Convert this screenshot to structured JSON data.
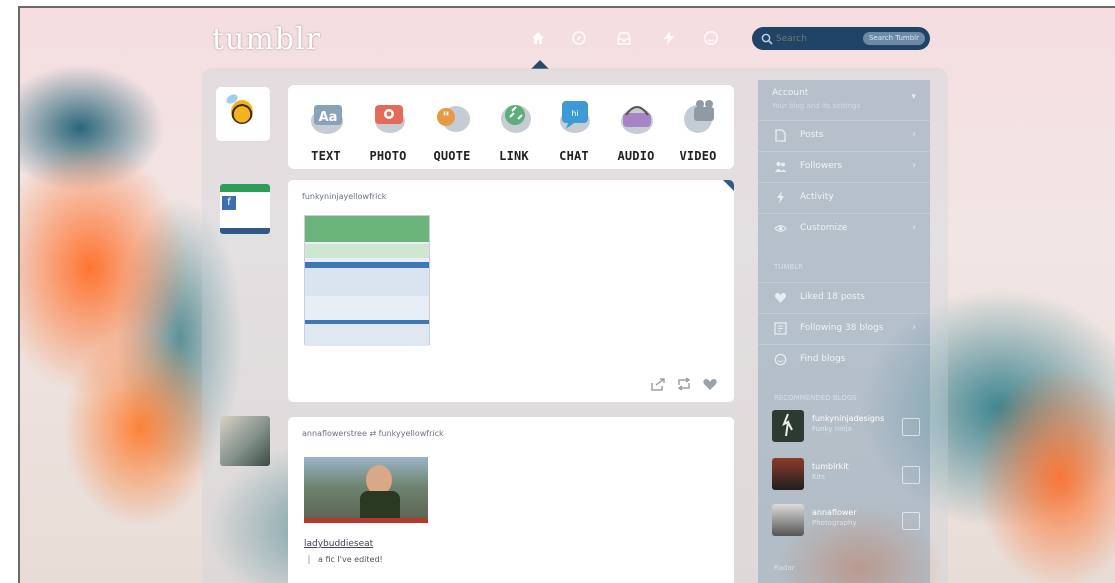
{
  "header": {
    "logo_text": "tumblr",
    "nav_icons": [
      "home-icon",
      "compass-icon",
      "inbox-icon",
      "lightning-icon",
      "smiley-icon"
    ],
    "search": {
      "placeholder": "Search",
      "pill_label": "Search Tumblr"
    }
  },
  "post_types": [
    {
      "label": "TEXT",
      "icon": "text-icon",
      "color": "#8aa2b8"
    },
    {
      "label": "PHOTO",
      "icon": "camera-icon",
      "color": "#e36b5a"
    },
    {
      "label": "QUOTE",
      "icon": "quote-icon",
      "color": "#e79a46"
    },
    {
      "label": "LINK",
      "icon": "link-icon",
      "color": "#5cae7a"
    },
    {
      "label": "CHAT",
      "icon": "chat-icon",
      "color": "#3d9ad6"
    },
    {
      "label": "AUDIO",
      "icon": "headphones-icon",
      "color": "#a784c7"
    },
    {
      "label": "VIDEO",
      "icon": "video-icon",
      "color": "#8f9aa4"
    }
  ],
  "posts": [
    {
      "author_line": "funkyninjayellowfrick",
      "actions": [
        "share-icon",
        "reblog-icon",
        "heart-icon"
      ]
    },
    {
      "author_line": "annaflowerstree ⇄ funkyyellowfrick",
      "title": "ladybuddieseat",
      "body": "a fic I've edited!"
    }
  ],
  "sidebar": {
    "account_label": "Account",
    "account_sub": "Your blog and its settings",
    "menu": [
      {
        "label": "Posts",
        "icon": "document-icon"
      },
      {
        "label": "Followers",
        "icon": "people-icon"
      },
      {
        "label": "Activity",
        "icon": "lightning-icon"
      },
      {
        "label": "Customize",
        "icon": "eye-icon"
      }
    ],
    "section_label": "TUMBLR",
    "links": [
      {
        "label": "Liked 18 posts",
        "icon": "heart-icon"
      },
      {
        "label": "Following 38 blogs",
        "icon": "following-icon"
      },
      {
        "label": "Find blogs",
        "icon": "smiley-icon"
      }
    ],
    "recommended_label": "RECOMMENDED BLOGS",
    "recommended": [
      {
        "name": "funkyninjadesigns",
        "desc": "Funky ninja"
      },
      {
        "name": "tumblrkit",
        "desc": "Kits"
      },
      {
        "name": "annaflower",
        "desc": "Photography"
      }
    ],
    "radar_label": "Radar"
  }
}
